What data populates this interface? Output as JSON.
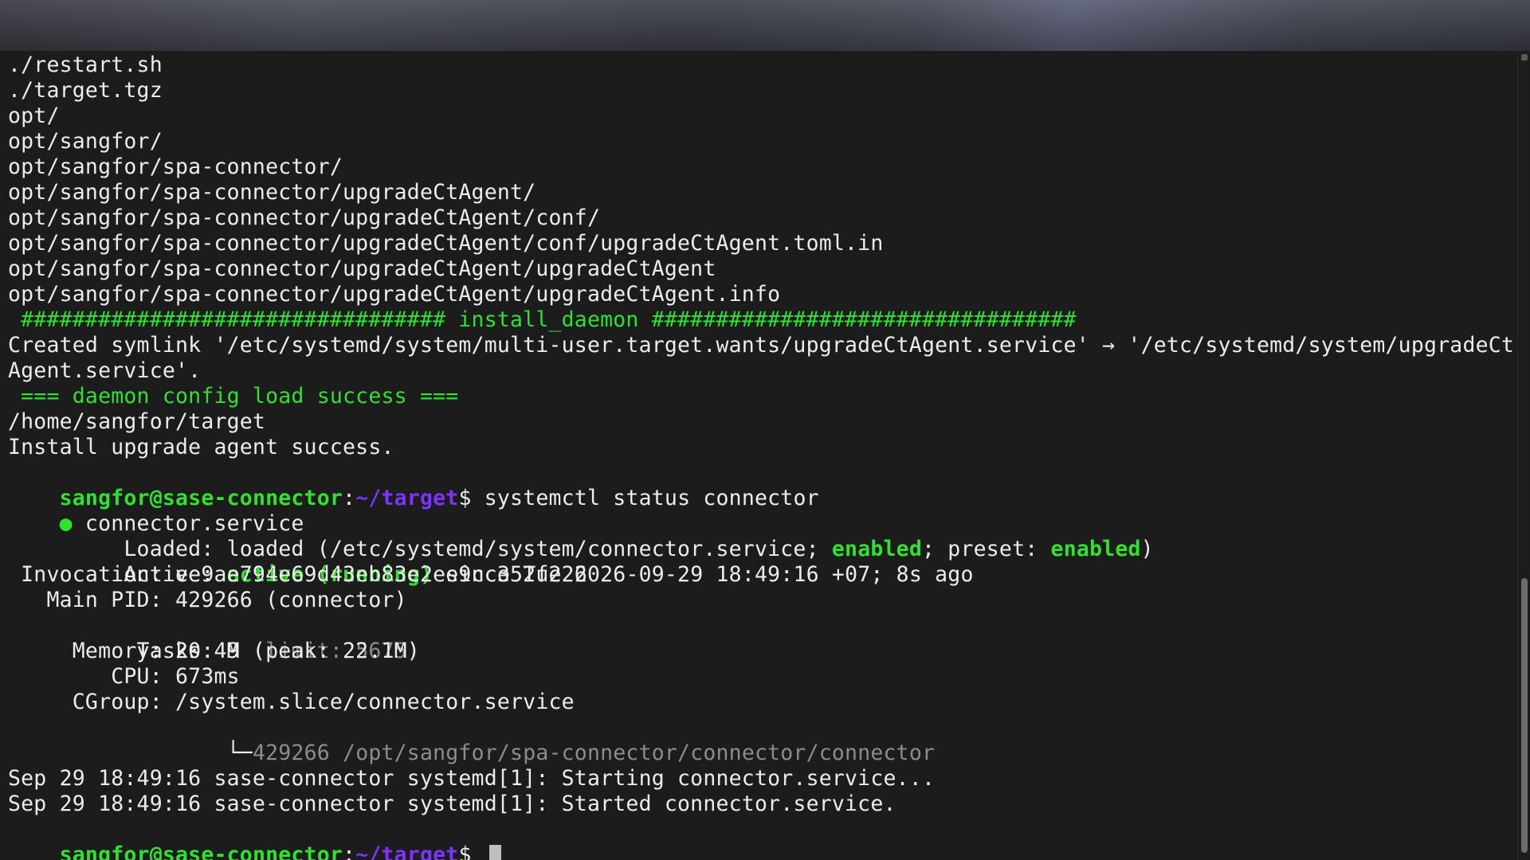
{
  "colors": {
    "background": "#1c1c1c",
    "text": "#ececec",
    "green": "#2fe22f",
    "prompt_path": "#7b33ff",
    "dim": "#8c8c8c"
  },
  "output": {
    "l1": "./restart.sh",
    "l2": "./target.tgz",
    "l3": "opt/",
    "l4": "opt/sangfor/",
    "l5": "opt/sangfor/spa-connector/",
    "l6": "opt/sangfor/spa-connector/upgradeCtAgent/",
    "l7": "opt/sangfor/spa-connector/upgradeCtAgent/conf/",
    "l8": "opt/sangfor/spa-connector/upgradeCtAgent/conf/upgradeCtAgent.toml.in",
    "l9": "opt/sangfor/spa-connector/upgradeCtAgent/upgradeCtAgent",
    "l10": "opt/sangfor/spa-connector/upgradeCtAgent/upgradeCtAgent.info",
    "install_banner": " ################################# install_daemon #################################",
    "symlink_1": "Created symlink '/etc/systemd/system/multi-user.target.wants/upgradeCtAgent.service' → '/etc/systemd/system/upgradeCt",
    "symlink_2": "Agent.service'.",
    "daemon_success": " === daemon config load success ===",
    "home_path": "/home/sangfor/target",
    "install_success": "Install upgrade agent success."
  },
  "prompt": {
    "user_host": "sangfor@sase-connector",
    "colon": ":",
    "path": "~/target",
    "dollar": "$ ",
    "command": "systemctl status connector"
  },
  "status": {
    "dot": "●",
    "service_name": " connector.service",
    "loaded_label": "     Loaded: ",
    "loaded_value_1": "loaded (/etc/systemd/system/connector.service; ",
    "enabled_1": "enabled",
    "loaded_value_2": "; preset: ",
    "enabled_2": "enabled",
    "loaded_value_3": ")",
    "active_label": "     Active: ",
    "active_state": "active (running)",
    "active_since": " since Tue 2026-09-29 18:49:16 +07; 8s ago",
    "invocation": " Invocation: ee9ae794e69d43eb83e2ee9cc352f226",
    "main_pid": "   Main PID: 429266 (connector)",
    "tasks_label": "      Tasks: 9 ",
    "tasks_limit": "(limit: 5675)",
    "memory": "     Memory: 20.4M (peak: 22.1M)",
    "cpu": "        CPU: 673ms",
    "cgroup": "     CGroup: /system.slice/connector.service",
    "cgroup_tree_prefix": "             └─",
    "cgroup_tree_value": "429266 /opt/sangfor/spa-connector/connector/connector"
  },
  "journal": {
    "line1": "Sep 29 18:49:16 sase-connector systemd[1]: Starting connector.service...",
    "line2": "Sep 29 18:49:16 sase-connector systemd[1]: Started connector.service."
  }
}
